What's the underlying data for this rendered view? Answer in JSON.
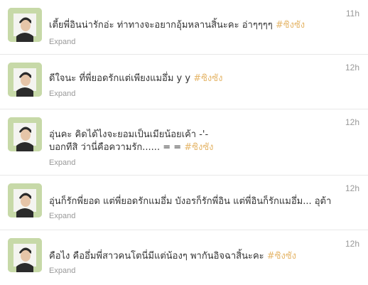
{
  "colors": {
    "hashtag": "#e5b66a",
    "meta_text": "#999999",
    "body_text": "#333333",
    "divider": "#e8e8e8",
    "avatar_background": "#c7d9a8"
  },
  "tweets": [
    {
      "time": "11h",
      "lines": [
        "เตี้ยพี่อินน่ารักอ่ะ ท่าทางจะอยากอุ้มหลานสิ้นะคะ อ่าๆๆๆๆ"
      ],
      "hashtag": "#ซิงซัง",
      "expand": "Expand"
    },
    {
      "time": "12h",
      "lines": [
        "ดีใจนะ ที่พี่ยอดรักแต่เพียงแมอึ่ม y y"
      ],
      "hashtag": "#ซิงซัง",
      "expand": "Expand"
    },
    {
      "time": "12h",
      "lines": [
        "อุ่นคะ คิดได้ไงจะยอมเป็นเมียน้อยเค้า -'-",
        "บอกทีสิ ว่านี่คือความรัก...... = ="
      ],
      "hashtag": "#ซิงซัง",
      "expand": "Expand"
    },
    {
      "time": "12h",
      "lines": [
        "อุ่นก็รักพี่ยอด แต่พี่ยอดรักแมอึ่ม บังอรก็รักพี่อิน แต่พี่อินก็รักแมอึ่ม... อุต้า"
      ],
      "hashtag": "",
      "expand": "Expand"
    },
    {
      "time": "12h",
      "lines": [
        "คือไง คืออึ่มพี่สาวคนโตนี่มีแต่น้องๆ พากันอิจฉาสิ้นะคะ"
      ],
      "hashtag": "#ซิงซัง",
      "expand": "Expand"
    }
  ]
}
